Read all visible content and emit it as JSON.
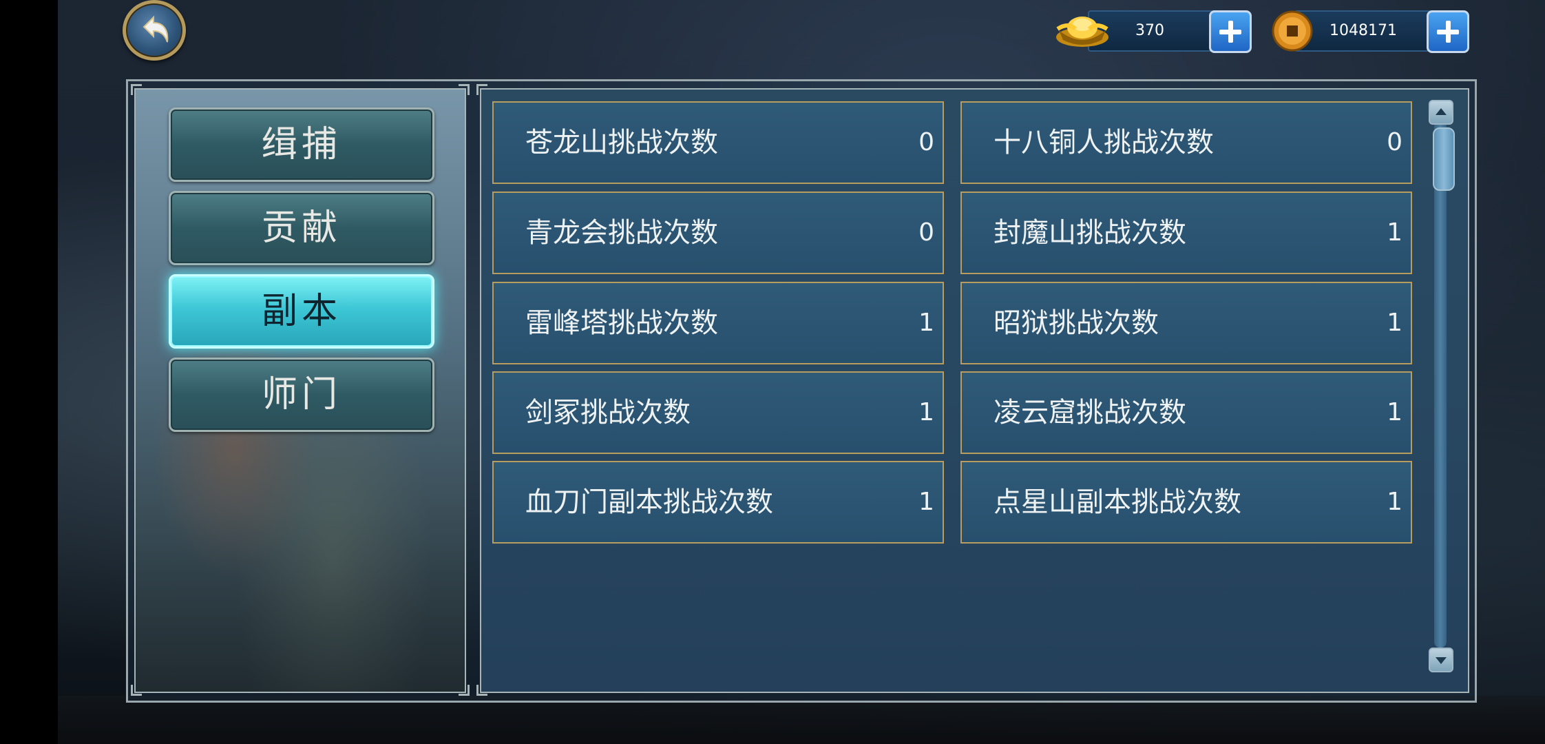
{
  "currencies": [
    {
      "name": "gold-ingot",
      "value": "370"
    },
    {
      "name": "copper-coin",
      "value": "1048171"
    }
  ],
  "tabs": [
    {
      "label": "缉捕",
      "active": false
    },
    {
      "label": "贡献",
      "active": false
    },
    {
      "label": "副本",
      "active": true
    },
    {
      "label": "师门",
      "active": false
    }
  ],
  "stats": [
    {
      "label": "苍龙山挑战次数",
      "value": "0"
    },
    {
      "label": "十八铜人挑战次数",
      "value": "0"
    },
    {
      "label": "青龙会挑战次数",
      "value": "0"
    },
    {
      "label": "封魔山挑战次数",
      "value": "1"
    },
    {
      "label": "雷峰塔挑战次数",
      "value": "1"
    },
    {
      "label": "昭狱挑战次数",
      "value": "1"
    },
    {
      "label": "剑冢挑战次数",
      "value": "1"
    },
    {
      "label": "凌云窟挑战次数",
      "value": "1"
    },
    {
      "label": "血刀门副本挑战次数",
      "value": "1"
    },
    {
      "label": "点星山副本挑战次数",
      "value": "1"
    }
  ],
  "icons": {
    "back": "back-arrow-icon",
    "gold": "gold-ingot-icon",
    "coin": "copper-coin-icon",
    "plus": "plus-icon",
    "scroll_up": "arrow-up-icon",
    "scroll_down": "arrow-down-icon"
  }
}
